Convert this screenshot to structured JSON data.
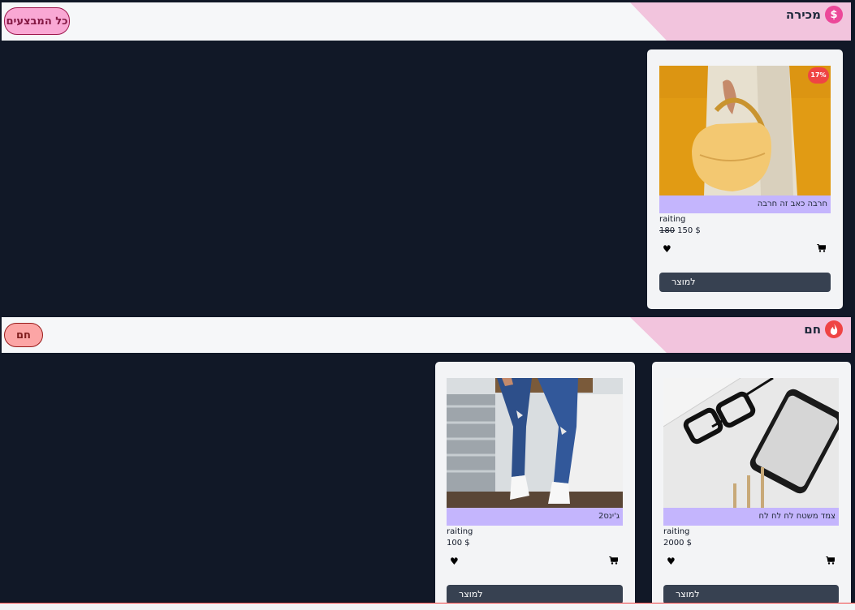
{
  "colors": {
    "page_bg": "#111827",
    "bar_bg": "#f6f7f9",
    "bar_triangle": "#f2c4dd",
    "sale_icon": "#ec4899",
    "hot_icon": "#ef4444",
    "label_bg": "#c4b5fd",
    "button_bg": "#374151",
    "badge_bg": "#ef4444"
  },
  "sale_section": {
    "title": "מכירה",
    "icon": "dollar-icon",
    "all_deals_button": "כל המבצעים",
    "products": [
      {
        "title": "חרבה כאב זה חרבה",
        "rating": "raiting",
        "old_price": "180",
        "price": "150 $",
        "discount": "17%",
        "button": "למוצר",
        "image": "yellow-handbag-photo"
      }
    ]
  },
  "hot_section": {
    "title": "חם",
    "icon": "fire-icon",
    "hot_button": "חם",
    "products": [
      {
        "title": "צמד משטח לח לח לח",
        "rating": "raiting",
        "price": "2000 $",
        "button": "למוצר",
        "image": "glasses-phone-pencils-photo"
      },
      {
        "title": "ג'ינס2",
        "rating": "raiting",
        "price": "100 $",
        "button": "למוצר",
        "image": "ripped-jeans-sneakers-photo"
      }
    ]
  }
}
